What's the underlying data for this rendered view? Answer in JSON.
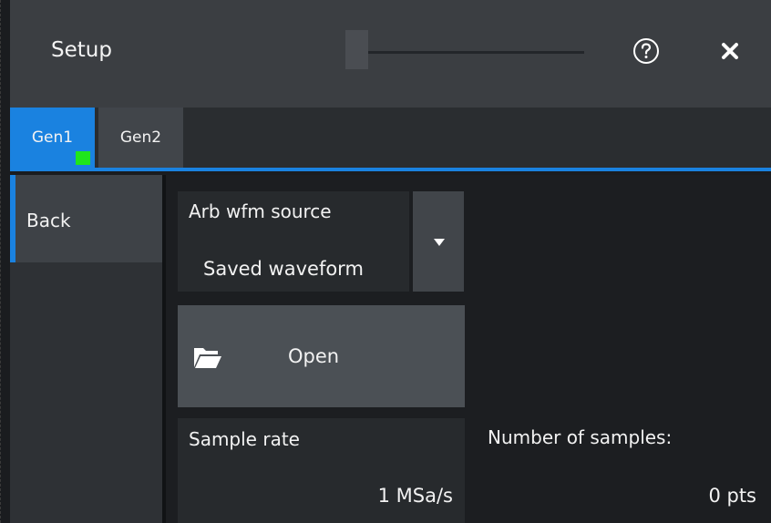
{
  "header": {
    "title": "Setup",
    "help_icon": "help-circle-icon",
    "close_icon": "close-icon"
  },
  "tabs": [
    {
      "label": "Gen1",
      "active": true
    },
    {
      "label": "Gen2",
      "active": false
    }
  ],
  "nav": {
    "back_label": "Back"
  },
  "arb": {
    "label": "Arb wfm source",
    "value": "Saved waveform",
    "dropdown_icon": "chevron-down-icon"
  },
  "open_button": {
    "label": "Open",
    "icon": "folder-open-icon"
  },
  "sample_rate": {
    "label": "Sample rate",
    "value": "1 MSa/s"
  },
  "samples": {
    "label": "Number of samples:",
    "value": "0 pts"
  },
  "colors": {
    "accent": "#1a82e0",
    "indicator": "#1fe51c"
  }
}
